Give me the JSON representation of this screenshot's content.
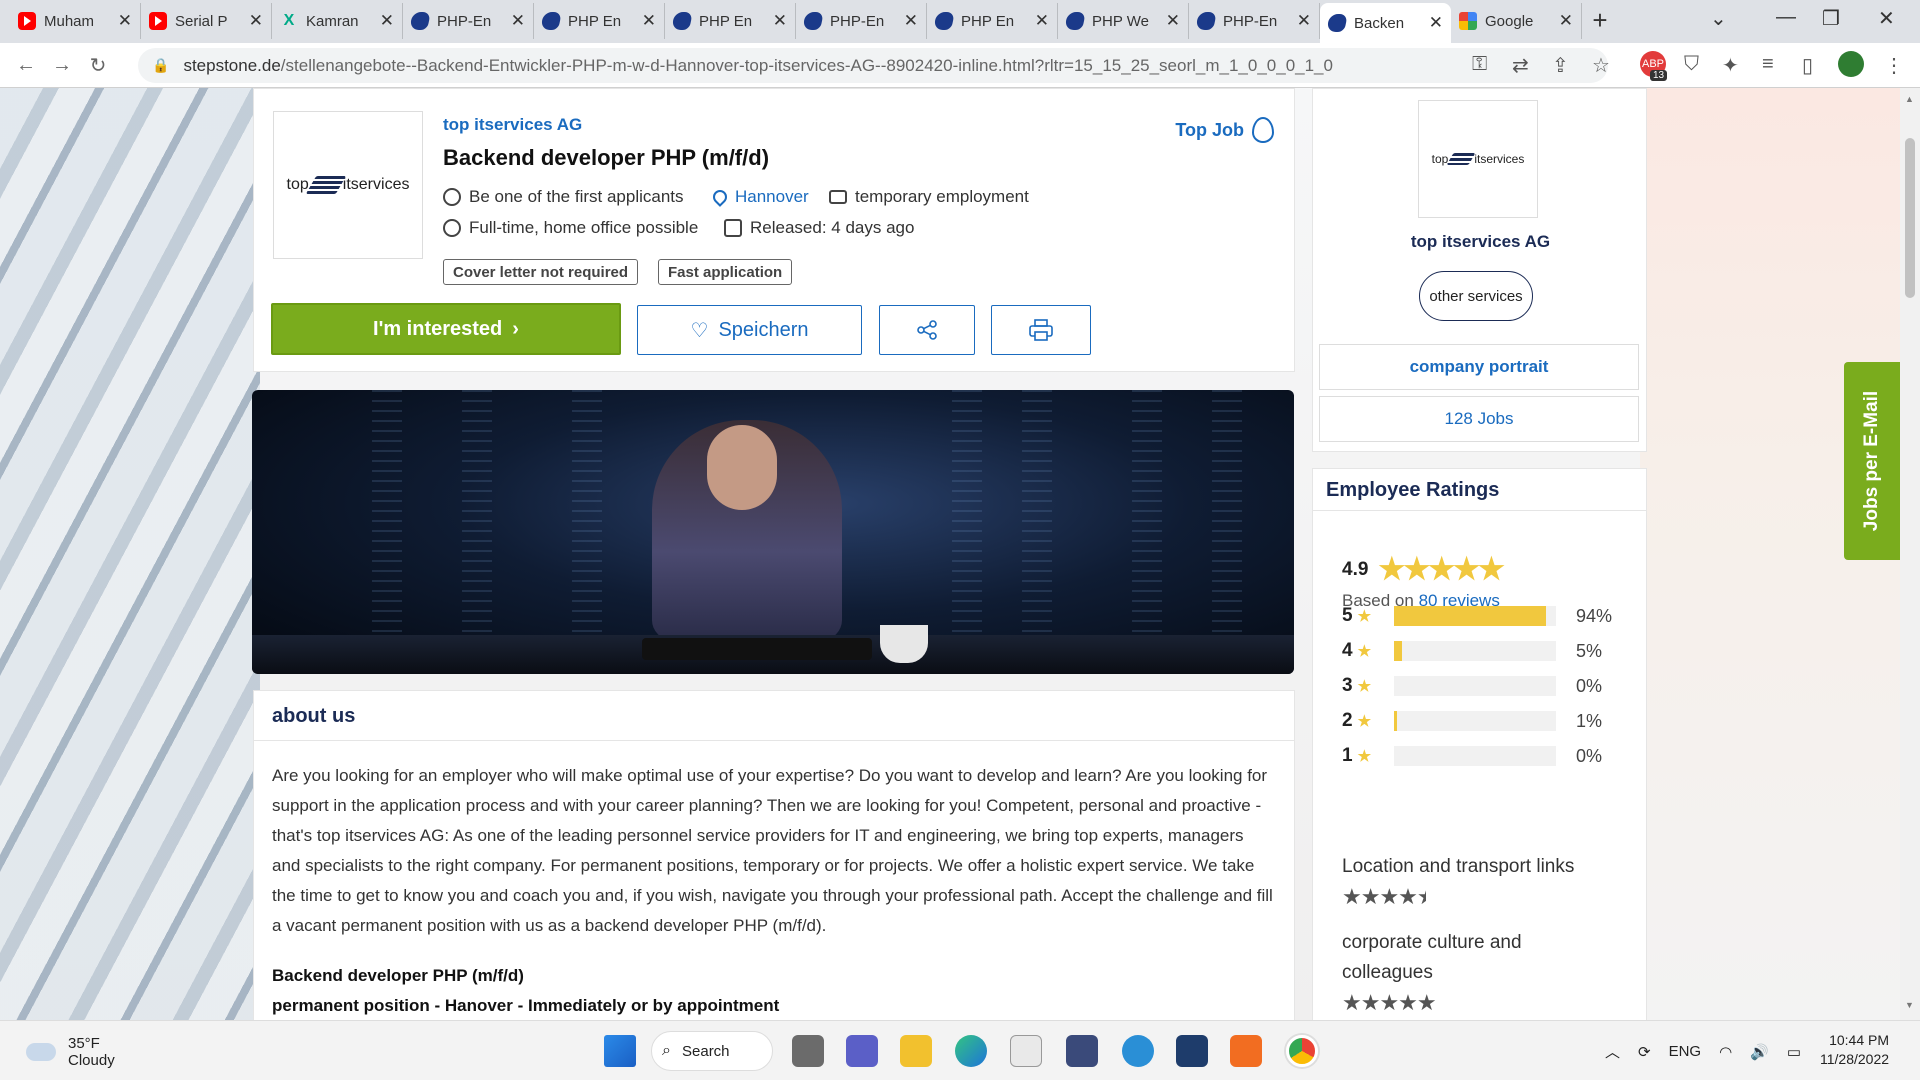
{
  "browser": {
    "tabs": [
      {
        "favicon": "youtube-icon",
        "label": "Muham"
      },
      {
        "favicon": "youtube-icon",
        "label": "Serial P"
      },
      {
        "favicon": "xing-icon",
        "label": "Kamran"
      },
      {
        "favicon": "stepstone-icon",
        "label": "PHP-En"
      },
      {
        "favicon": "stepstone-icon",
        "label": "PHP En"
      },
      {
        "favicon": "stepstone-icon",
        "label": "PHP En"
      },
      {
        "favicon": "stepstone-icon",
        "label": "PHP-En"
      },
      {
        "favicon": "stepstone-icon",
        "label": "PHP En"
      },
      {
        "favicon": "stepstone-icon",
        "label": "PHP We"
      },
      {
        "favicon": "stepstone-icon",
        "label": "PHP-En"
      },
      {
        "favicon": "stepstone-icon",
        "label": "Backen",
        "active": true
      },
      {
        "favicon": "google-icon",
        "label": "Google"
      }
    ],
    "url_host": "stepstone.de",
    "url_path": "/stellenangebote--Backend-Entwickler-PHP-m-w-d-Hannover-top-itservices-AG--8902420-inline.html?rltr=15_15_25_seorl_m_1_0_0_0_1_0",
    "extension_badge": "13"
  },
  "job": {
    "company": "top itservices AG",
    "logo_text_left": "top",
    "logo_text_right": "itservices",
    "title": "Backend developer PHP (m/f/d)",
    "top_job_label": "Top Job",
    "applicants": "Be one of the first applicants",
    "location": "Hannover",
    "employment_type": "temporary employment",
    "work_mode": "Full-time, home office possible",
    "released": "Released: 4 days ago",
    "tags": [
      "Cover letter not required",
      "Fast application"
    ],
    "interested_label": "I'm interested",
    "save_label": "Speichern"
  },
  "about": {
    "heading": "about us",
    "body": "Are you looking for an employer who will make optimal use of your expertise? Do you want to develop and learn? Are you looking for support in the application process and with your career planning? Then we are looking for you! Competent, personal and proactive - that's top itservices AG: As one of the leading personnel service providers for IT and engineering, we bring top experts, managers and specialists to the right company. For permanent positions, temporary or for projects. We offer a holistic expert service. We take the time to get to know you and coach you and, if you wish, navigate you through your professional path. Accept the challenge and fill a vacant permanent position with us as a backend developer PHP (m/f/d).",
    "sub_title": "Backend developer PHP (m/f/d)",
    "sub_line": "permanent position - Hanover - Immediately or by appointment"
  },
  "company_card": {
    "name": "top itservices AG",
    "other_services": "other services",
    "portrait": "company portrait",
    "jobs": "128 Jobs"
  },
  "ratings": {
    "heading": "Employee Ratings",
    "score": "4.9",
    "based_prefix": "Based on",
    "reviews_link": "80 reviews",
    "distribution": [
      {
        "stars": "5",
        "percent": 94,
        "label": "94%"
      },
      {
        "stars": "4",
        "percent": 5,
        "label": "5%"
      },
      {
        "stars": "3",
        "percent": 0,
        "label": "0%"
      },
      {
        "stars": "2",
        "percent": 1,
        "label": "1%"
      },
      {
        "stars": "1",
        "percent": 0,
        "label": "0%"
      }
    ],
    "categories": [
      {
        "label": "Location and transport links",
        "stars": 4.5
      },
      {
        "label": "corporate culture and colleagues",
        "stars": 5
      }
    ]
  },
  "email_tab": "Jobs per E-Mail",
  "taskbar": {
    "temp": "35°F",
    "condition": "Cloudy",
    "search_label": "Search",
    "language": "ENG",
    "time": "10:44 PM",
    "date": "11/28/2022"
  },
  "colors": {
    "accent_blue": "#1a6bbf",
    "brand_green": "#7aac1d",
    "star_yellow": "#f1c83e"
  }
}
